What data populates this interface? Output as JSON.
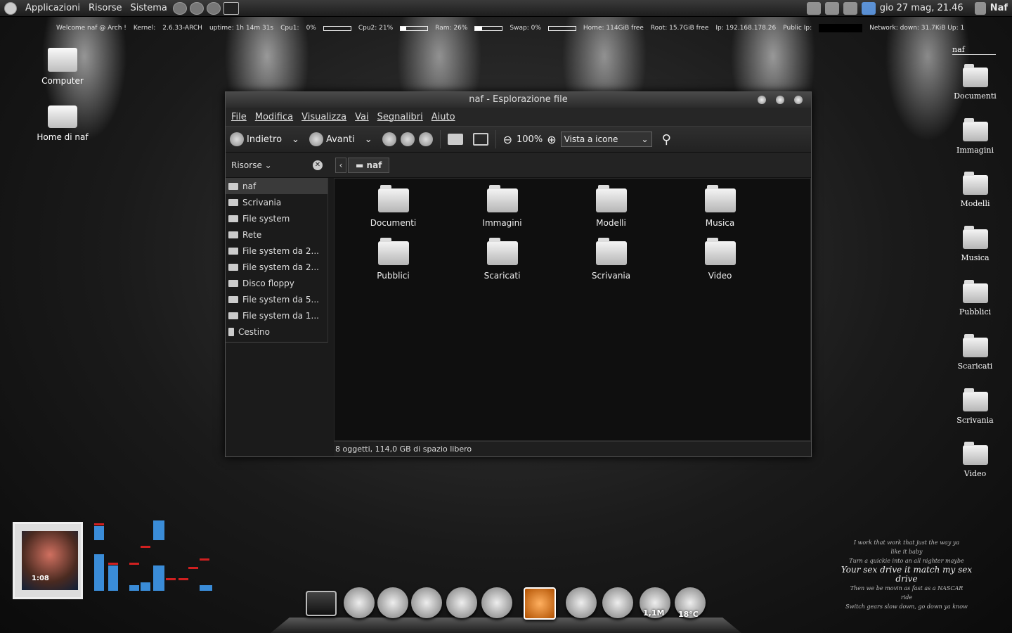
{
  "topbar": {
    "menus": [
      "Applicazioni",
      "Risorse",
      "Sistema"
    ],
    "datetime": "gio 27 mag, 21.46",
    "user": "Naf"
  },
  "conky": {
    "welcome": "Welcome naf @ Arch !",
    "kernel_label": "Kernel:",
    "kernel": "2.6.33-ARCH",
    "uptime": "uptime: 1h 14m 31s",
    "cpu1_label": "Cpu1:",
    "cpu1": "0%",
    "cpu1_level": 0.0,
    "cpu2": "Cpu2: 21%",
    "cpu2_level": 0.21,
    "ram": "Ram: 26%",
    "ram_level": 0.26,
    "swap": "Swap: 0%",
    "swap_level": 0.0,
    "home": "Home: 114GiB free",
    "root": "Root: 15.7GiB free",
    "ip": "Ip: 192.168.178.26",
    "public_ip": "Public Ip:",
    "network": "Network: down: 31.7KiB  Up: 1"
  },
  "desktop_left": [
    {
      "label": "Computer"
    },
    {
      "label": "Home di naf"
    }
  ],
  "desktop_right": {
    "title": "naf",
    "items": [
      "Documenti",
      "Immagini",
      "Modelli",
      "Musica",
      "Pubblici",
      "Scaricati",
      "Scrivania",
      "Video"
    ]
  },
  "window": {
    "title": "naf - Esplorazione file",
    "menus": [
      "File",
      "Modifica",
      "Visualizza",
      "Vai",
      "Segnalibri",
      "Aiuto"
    ],
    "toolbar": {
      "back": "Indietro",
      "forward": "Avanti",
      "zoom": "100%",
      "view": "Vista a icone"
    },
    "sidebar_title": "Risorse",
    "path": "naf",
    "sidebar": [
      "naf",
      "Scrivania",
      "File system",
      "Rete",
      "File system da 2...",
      "File system da 2...",
      "Disco floppy",
      "File system da 5...",
      "File system da 1...",
      "Cestino"
    ],
    "files": [
      "Documenti",
      "Immagini",
      "Modelli",
      "Musica",
      "Pubblici",
      "Scaricati",
      "Scrivania",
      "Video"
    ],
    "status": "8 oggetti, 114,0 GB di spazio libero"
  },
  "player": {
    "time": "1:08"
  },
  "dock": {
    "download_label": "1,1M",
    "weather": "18°C"
  },
  "lyrics": [
    "I work that work that just the way ya",
    "like it baby",
    "Turn a quickie into an all nighter maybe",
    "Your sex drive it match my sex drive",
    "Then we be movin as fast as a NASCAR",
    "ride",
    "Switch gears slow down, go down ya know"
  ]
}
